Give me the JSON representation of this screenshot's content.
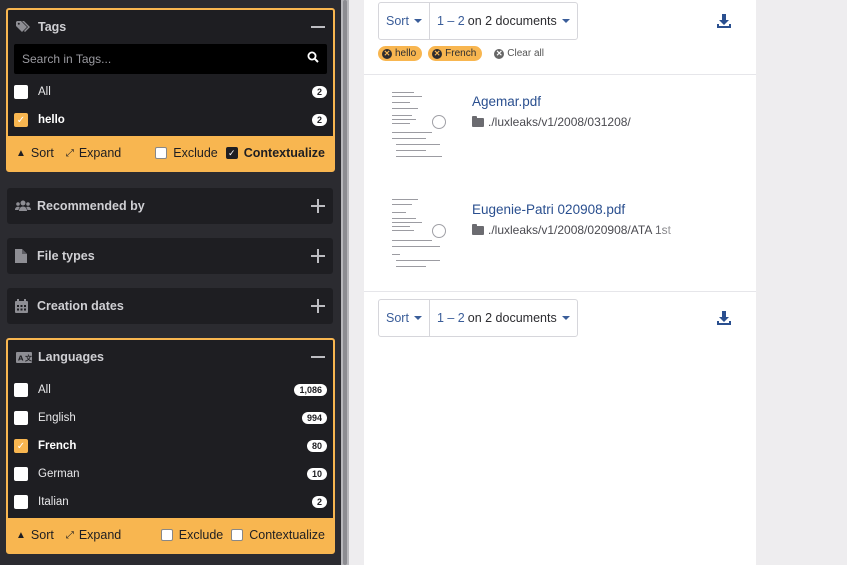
{
  "sidebar": {
    "tags": {
      "title": "Tags",
      "search_placeholder": "Search in Tags...",
      "items": [
        {
          "label": "All",
          "count": "2",
          "checked": false
        },
        {
          "label": "hello",
          "count": "2",
          "checked": true
        }
      ],
      "footer": {
        "sort": "Sort",
        "expand": "Expand",
        "exclude": "Exclude",
        "contextualize": "Contextualize"
      }
    },
    "recommended": {
      "title": "Recommended by"
    },
    "file_types": {
      "title": "File types"
    },
    "creation_dates": {
      "title": "Creation dates"
    },
    "languages": {
      "title": "Languages",
      "items": [
        {
          "label": "All",
          "count": "1,086",
          "checked": false
        },
        {
          "label": "English",
          "count": "994",
          "checked": false
        },
        {
          "label": "French",
          "count": "80",
          "checked": true
        },
        {
          "label": "German",
          "count": "10",
          "checked": false
        },
        {
          "label": "Italian",
          "count": "2",
          "checked": false
        }
      ],
      "footer": {
        "sort": "Sort",
        "expand": "Expand",
        "exclude": "Exclude",
        "contextualize": "Contextualize"
      }
    }
  },
  "results": {
    "top_toolbar": {
      "sort": "Sort",
      "range": "1 – 2",
      "range_suffix": "on 2 documents"
    },
    "bottom_toolbar": {
      "sort": "Sort",
      "range": "1 – 2",
      "range_suffix": "on 2 documents"
    },
    "filters": [
      {
        "label": "hello"
      },
      {
        "label": "French"
      }
    ],
    "clear_all": "Clear all",
    "documents": [
      {
        "title": "Agemar.pdf",
        "path": "./luxleaks/v1/2008/031208/"
      },
      {
        "title": "Eugenie-Patri 020908.pdf",
        "path": "./luxleaks/v1/2008/020908/ATA 1st"
      }
    ]
  },
  "colors": {
    "accent": "#f8b650",
    "sidebar_bg": "#2b2b30",
    "panel_bg": "#1e1e22",
    "link": "#2a4f8f"
  }
}
